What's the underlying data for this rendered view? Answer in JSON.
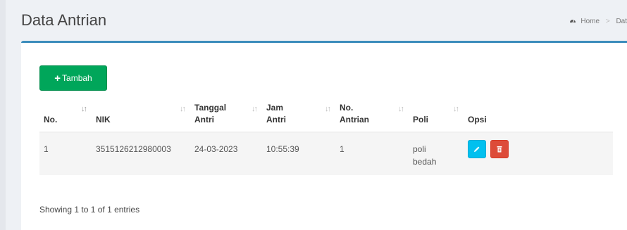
{
  "header": {
    "title": "Data Antrian",
    "breadcrumb": [
      "Home",
      "Dat"
    ]
  },
  "toolbar": {
    "add_label": "Tambah",
    "add_icon": "plus-icon"
  },
  "table": {
    "columns": [
      "No.",
      "NIK",
      "Tanggal Antri",
      "Jam Antri",
      "No. Antrian",
      "Poli",
      "Opsi"
    ],
    "rows": [
      {
        "no": "1",
        "nik": "3515126212980003",
        "tanggal": "24-03-2023",
        "jam": "10:55:39",
        "antrian": "1",
        "poli": "poli bedah",
        "actions": [
          "edit-icon",
          "trash-icon"
        ]
      }
    ]
  },
  "footer": {
    "info": "Showing 1 to 1 of 1 entries"
  },
  "colors": {
    "accent": "#3c8dbc",
    "add_button": "#00a65a",
    "edit_button": "#00c0ef",
    "delete_button": "#dd4b39"
  }
}
